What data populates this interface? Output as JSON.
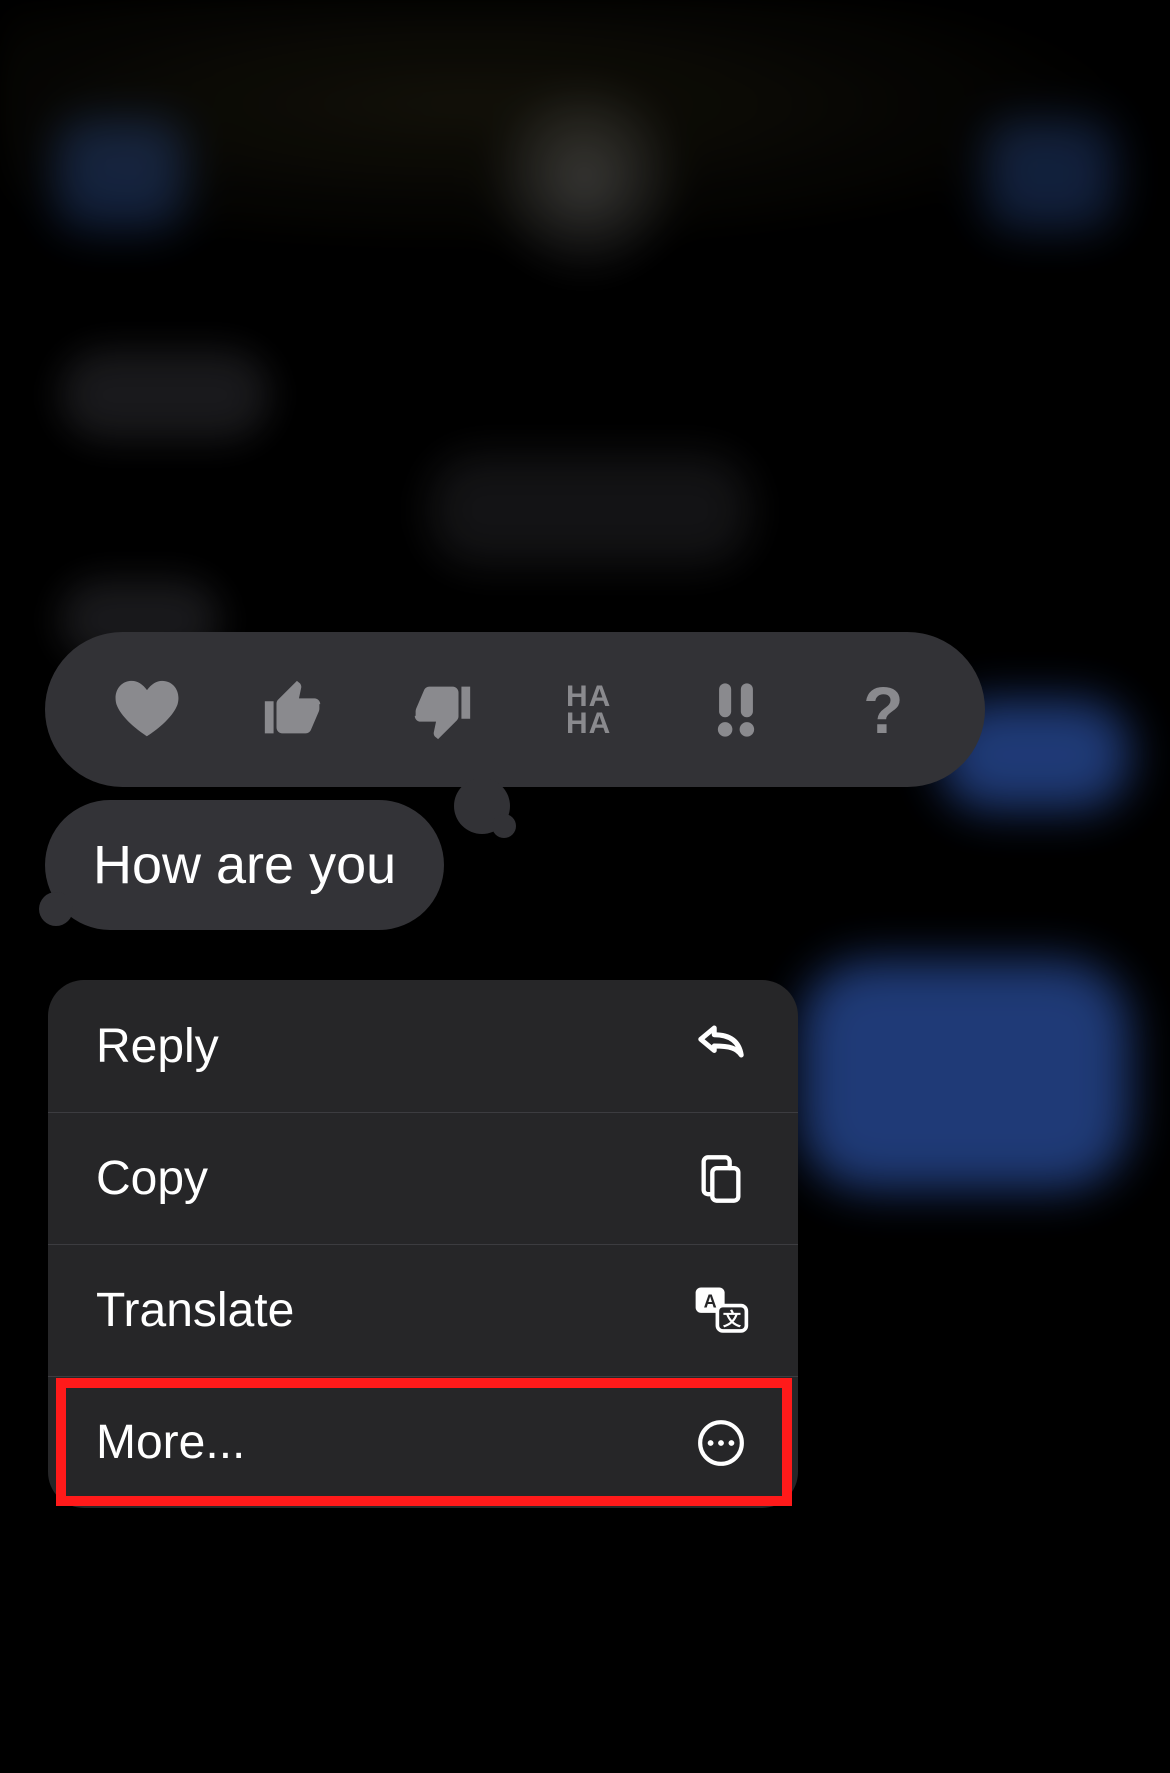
{
  "tapbacks": {
    "heart": "heart",
    "thumbs_up": "thumbs-up",
    "thumbs_down": "thumbs-down",
    "haha": "HA HA",
    "emphasize": "!!",
    "question": "?"
  },
  "message": {
    "text": "How are you"
  },
  "menu": {
    "reply": "Reply",
    "copy": "Copy",
    "translate": "Translate",
    "more": "More..."
  },
  "colors": {
    "accent": "#448aff",
    "highlight": "#ff1a1a"
  }
}
